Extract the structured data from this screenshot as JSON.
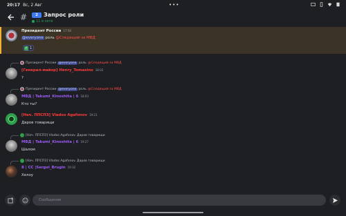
{
  "status": {
    "time": "20:17",
    "date": "Вс, 2 Авг"
  },
  "header": {
    "badge": "2",
    "title": "Запрос роли",
    "online": "11 в сети"
  },
  "messages": [
    {
      "author": "Президент России",
      "time": "17:58",
      "mention": "@everyone",
      "body": "роль",
      "role_mention": "@Следящий за МВД",
      "reaction_count": "1"
    },
    {
      "reply_author": "Президент России",
      "reply_mention": "@everyone",
      "reply_body": "роль",
      "reply_role": "@Следящий за МВД",
      "author": "[Генерал-майор] Henry_Tomasino",
      "time": "18:02",
      "body": "?"
    },
    {
      "reply_author": "Президент России",
      "reply_mention": "@everyone",
      "reply_body": "роль",
      "reply_role": "@Следящий за МВД",
      "author": "МВД | Takumi_Kinoshita | 6",
      "time": "18:03",
      "body": "Кто ты?"
    },
    {
      "author": "[Нач. ППСПЗ] Vlados Agafonov",
      "time": "19:21",
      "body": "Даров товарищи"
    },
    {
      "reply_author": "[Нач. ППСПЗ] Vlados Agafonov",
      "reply_body": "Даров товарищи",
      "author": "МВД | Takumi_Kinoshita | 6",
      "time": "19:27",
      "body": "Шалом"
    },
    {
      "reply_author": "[Нач. ППСПЗ] Vlados Agafonov",
      "reply_body": "Даров товарищи",
      "author": "8 | СС |Sergei_Brugin",
      "time": "19:32",
      "body": "Хелоу"
    }
  ],
  "input": {
    "placeholder": "Сообщение"
  },
  "colors": {
    "accent": "#f0b232",
    "red_role": "#ff3b3b",
    "purple_role": "#9b5cf4",
    "mention_bg": "#3e4a8a"
  }
}
